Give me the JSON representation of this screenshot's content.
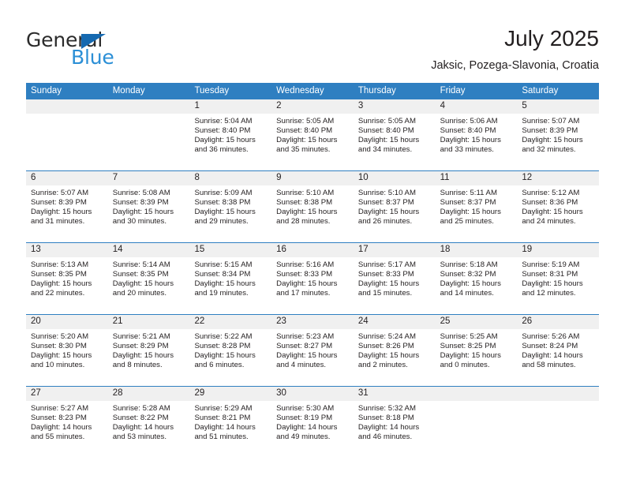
{
  "brand": {
    "name_part1": "General",
    "name_part2": "Blue",
    "flag_icon": "blue-triangle-flag-icon",
    "accent_color": "#1569b0",
    "secondary_color": "#2b8fd6"
  },
  "header": {
    "title": "July 2025",
    "subtitle": "Jaksic, Pozega-Slavonia, Croatia"
  },
  "theme": {
    "header_blue": "#2f7fc1",
    "band_grey": "#f0f0f0",
    "text": "#231f20"
  },
  "weekdays": [
    "Sunday",
    "Monday",
    "Tuesday",
    "Wednesday",
    "Thursday",
    "Friday",
    "Saturday"
  ],
  "weeks": [
    [
      {
        "day": "",
        "sunrise": "",
        "sunset": "",
        "daylight": ""
      },
      {
        "day": "",
        "sunrise": "",
        "sunset": "",
        "daylight": ""
      },
      {
        "day": "1",
        "sunrise": "Sunrise: 5:04 AM",
        "sunset": "Sunset: 8:40 PM",
        "daylight": "Daylight: 15 hours and 36 minutes."
      },
      {
        "day": "2",
        "sunrise": "Sunrise: 5:05 AM",
        "sunset": "Sunset: 8:40 PM",
        "daylight": "Daylight: 15 hours and 35 minutes."
      },
      {
        "day": "3",
        "sunrise": "Sunrise: 5:05 AM",
        "sunset": "Sunset: 8:40 PM",
        "daylight": "Daylight: 15 hours and 34 minutes."
      },
      {
        "day": "4",
        "sunrise": "Sunrise: 5:06 AM",
        "sunset": "Sunset: 8:40 PM",
        "daylight": "Daylight: 15 hours and 33 minutes."
      },
      {
        "day": "5",
        "sunrise": "Sunrise: 5:07 AM",
        "sunset": "Sunset: 8:39 PM",
        "daylight": "Daylight: 15 hours and 32 minutes."
      }
    ],
    [
      {
        "day": "6",
        "sunrise": "Sunrise: 5:07 AM",
        "sunset": "Sunset: 8:39 PM",
        "daylight": "Daylight: 15 hours and 31 minutes."
      },
      {
        "day": "7",
        "sunrise": "Sunrise: 5:08 AM",
        "sunset": "Sunset: 8:39 PM",
        "daylight": "Daylight: 15 hours and 30 minutes."
      },
      {
        "day": "8",
        "sunrise": "Sunrise: 5:09 AM",
        "sunset": "Sunset: 8:38 PM",
        "daylight": "Daylight: 15 hours and 29 minutes."
      },
      {
        "day": "9",
        "sunrise": "Sunrise: 5:10 AM",
        "sunset": "Sunset: 8:38 PM",
        "daylight": "Daylight: 15 hours and 28 minutes."
      },
      {
        "day": "10",
        "sunrise": "Sunrise: 5:10 AM",
        "sunset": "Sunset: 8:37 PM",
        "daylight": "Daylight: 15 hours and 26 minutes."
      },
      {
        "day": "11",
        "sunrise": "Sunrise: 5:11 AM",
        "sunset": "Sunset: 8:37 PM",
        "daylight": "Daylight: 15 hours and 25 minutes."
      },
      {
        "day": "12",
        "sunrise": "Sunrise: 5:12 AM",
        "sunset": "Sunset: 8:36 PM",
        "daylight": "Daylight: 15 hours and 24 minutes."
      }
    ],
    [
      {
        "day": "13",
        "sunrise": "Sunrise: 5:13 AM",
        "sunset": "Sunset: 8:35 PM",
        "daylight": "Daylight: 15 hours and 22 minutes."
      },
      {
        "day": "14",
        "sunrise": "Sunrise: 5:14 AM",
        "sunset": "Sunset: 8:35 PM",
        "daylight": "Daylight: 15 hours and 20 minutes."
      },
      {
        "day": "15",
        "sunrise": "Sunrise: 5:15 AM",
        "sunset": "Sunset: 8:34 PM",
        "daylight": "Daylight: 15 hours and 19 minutes."
      },
      {
        "day": "16",
        "sunrise": "Sunrise: 5:16 AM",
        "sunset": "Sunset: 8:33 PM",
        "daylight": "Daylight: 15 hours and 17 minutes."
      },
      {
        "day": "17",
        "sunrise": "Sunrise: 5:17 AM",
        "sunset": "Sunset: 8:33 PM",
        "daylight": "Daylight: 15 hours and 15 minutes."
      },
      {
        "day": "18",
        "sunrise": "Sunrise: 5:18 AM",
        "sunset": "Sunset: 8:32 PM",
        "daylight": "Daylight: 15 hours and 14 minutes."
      },
      {
        "day": "19",
        "sunrise": "Sunrise: 5:19 AM",
        "sunset": "Sunset: 8:31 PM",
        "daylight": "Daylight: 15 hours and 12 minutes."
      }
    ],
    [
      {
        "day": "20",
        "sunrise": "Sunrise: 5:20 AM",
        "sunset": "Sunset: 8:30 PM",
        "daylight": "Daylight: 15 hours and 10 minutes."
      },
      {
        "day": "21",
        "sunrise": "Sunrise: 5:21 AM",
        "sunset": "Sunset: 8:29 PM",
        "daylight": "Daylight: 15 hours and 8 minutes."
      },
      {
        "day": "22",
        "sunrise": "Sunrise: 5:22 AM",
        "sunset": "Sunset: 8:28 PM",
        "daylight": "Daylight: 15 hours and 6 minutes."
      },
      {
        "day": "23",
        "sunrise": "Sunrise: 5:23 AM",
        "sunset": "Sunset: 8:27 PM",
        "daylight": "Daylight: 15 hours and 4 minutes."
      },
      {
        "day": "24",
        "sunrise": "Sunrise: 5:24 AM",
        "sunset": "Sunset: 8:26 PM",
        "daylight": "Daylight: 15 hours and 2 minutes."
      },
      {
        "day": "25",
        "sunrise": "Sunrise: 5:25 AM",
        "sunset": "Sunset: 8:25 PM",
        "daylight": "Daylight: 15 hours and 0 minutes."
      },
      {
        "day": "26",
        "sunrise": "Sunrise: 5:26 AM",
        "sunset": "Sunset: 8:24 PM",
        "daylight": "Daylight: 14 hours and 58 minutes."
      }
    ],
    [
      {
        "day": "27",
        "sunrise": "Sunrise: 5:27 AM",
        "sunset": "Sunset: 8:23 PM",
        "daylight": "Daylight: 14 hours and 55 minutes."
      },
      {
        "day": "28",
        "sunrise": "Sunrise: 5:28 AM",
        "sunset": "Sunset: 8:22 PM",
        "daylight": "Daylight: 14 hours and 53 minutes."
      },
      {
        "day": "29",
        "sunrise": "Sunrise: 5:29 AM",
        "sunset": "Sunset: 8:21 PM",
        "daylight": "Daylight: 14 hours and 51 minutes."
      },
      {
        "day": "30",
        "sunrise": "Sunrise: 5:30 AM",
        "sunset": "Sunset: 8:19 PM",
        "daylight": "Daylight: 14 hours and 49 minutes."
      },
      {
        "day": "31",
        "sunrise": "Sunrise: 5:32 AM",
        "sunset": "Sunset: 8:18 PM",
        "daylight": "Daylight: 14 hours and 46 minutes."
      },
      {
        "day": "",
        "sunrise": "",
        "sunset": "",
        "daylight": ""
      },
      {
        "day": "",
        "sunrise": "",
        "sunset": "",
        "daylight": ""
      }
    ]
  ]
}
